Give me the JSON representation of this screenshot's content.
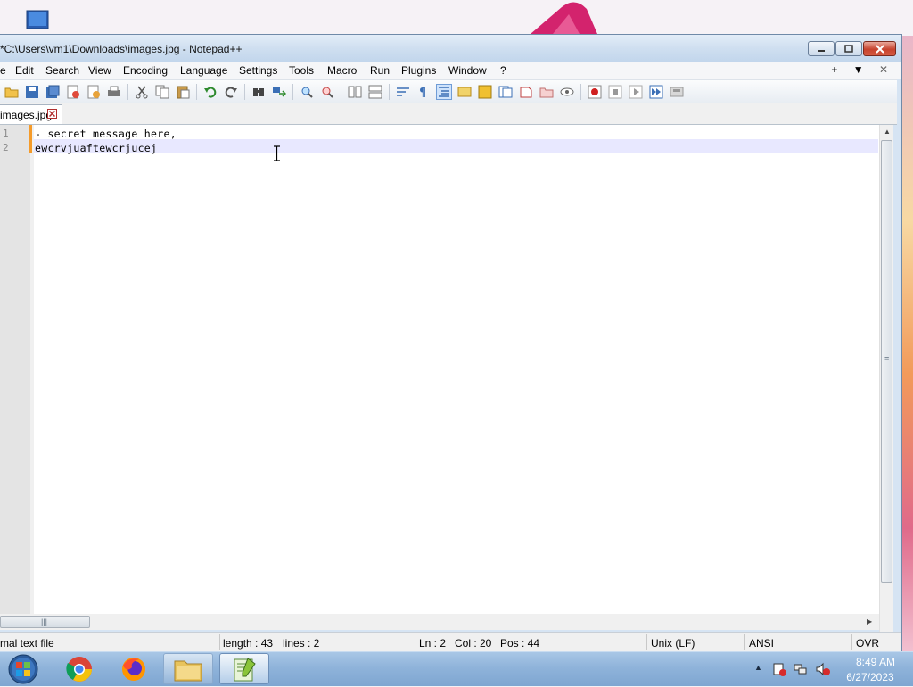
{
  "window": {
    "title": "*C:\\Users\\vm1\\Downloads\\images.jpg - Notepad++"
  },
  "menu": {
    "items": [
      "e",
      "Edit",
      "Search",
      "View",
      "Encoding",
      "Language",
      "Settings",
      "Tools",
      "Macro",
      "Run",
      "Plugins",
      "Window",
      "?"
    ],
    "right": [
      "+",
      "▼",
      "✕"
    ]
  },
  "tab": {
    "label": "images.jpg"
  },
  "editor": {
    "lines": [
      {
        "number": "1",
        "text": "- secret message here,"
      },
      {
        "number": "2",
        "text": "ewcrvjuaftewcrjucej"
      }
    ]
  },
  "status": {
    "file_type": "mal text file",
    "length": "length : 43",
    "lines": "lines : 2",
    "ln": "Ln : 2",
    "col": "Col : 20",
    "pos": "Pos : 44",
    "eol": "Unix (LF)",
    "encoding": "ANSI",
    "mode": "OVR"
  },
  "taskbar": {
    "time": "8:49 AM",
    "date": "6/27/2023",
    "apps": [
      "start-orb",
      "chrome",
      "firefox",
      "file-explorer",
      "notepad-plus-plus"
    ]
  },
  "colors": {
    "title_bar": "#cfdff0",
    "taskbar": "#8fb3da",
    "caret_line": "#e8e8ff",
    "change_marker": "#f59b2a"
  }
}
